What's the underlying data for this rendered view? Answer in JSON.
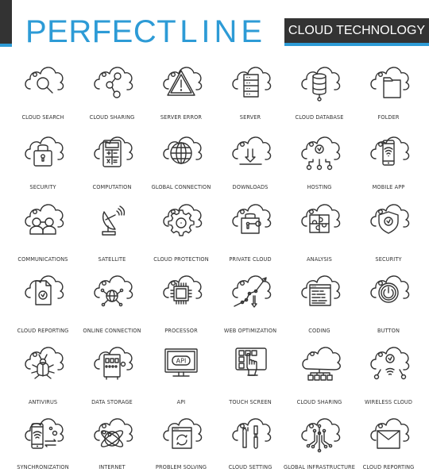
{
  "header": {
    "brand_bold": "PERFECT",
    "brand_thin": "LINE",
    "tag": "CLOUD TECHNOLOGY",
    "colors": {
      "accent": "#2d9bd6",
      "dark": "#333333",
      "stroke": "#333333"
    }
  },
  "icons": [
    [
      {
        "label": "CLOUD SEARCH",
        "icon": "cloud-search-icon"
      },
      {
        "label": "CLOUD SHARING",
        "icon": "cloud-sharing-icon"
      },
      {
        "label": "SERVER ERROR",
        "icon": "server-error-icon"
      },
      {
        "label": "SERVER",
        "icon": "server-icon"
      },
      {
        "label": "CLOUD DATABASE",
        "icon": "cloud-database-icon"
      },
      {
        "label": "FOLDER",
        "icon": "folder-icon"
      }
    ],
    [
      {
        "label": "SECURITY",
        "icon": "lock-icon"
      },
      {
        "label": "COMPUTATION",
        "icon": "calculator-icon"
      },
      {
        "label": "GLOBAL CONNECTION",
        "icon": "globe-icon"
      },
      {
        "label": "DOWNLOADS",
        "icon": "download-icon"
      },
      {
        "label": "HOSTING",
        "icon": "hosting-icon"
      },
      {
        "label": "MOBILE APP",
        "icon": "mobile-app-icon"
      }
    ],
    [
      {
        "label": "COMMUNICATIONS",
        "icon": "communications-icon"
      },
      {
        "label": "SATELLITE",
        "icon": "satellite-dish-icon"
      },
      {
        "label": "CLOUD PROTECTION",
        "icon": "gear-icon"
      },
      {
        "label": "PRIVATE CLOUD",
        "icon": "padlock-key-icon"
      },
      {
        "label": "ANALYSIS",
        "icon": "puzzle-icon"
      },
      {
        "label": "SECURITY",
        "icon": "shield-check-icon"
      }
    ],
    [
      {
        "label": "CLOUD REPORTING",
        "icon": "document-check-icon"
      },
      {
        "label": "ONLINE CONNECTION",
        "icon": "network-globe-icon"
      },
      {
        "label": "PROCESSOR",
        "icon": "chip-icon"
      },
      {
        "label": "WEB OPTIMIZATION",
        "icon": "growth-chart-icon"
      },
      {
        "label": "CODING",
        "icon": "code-window-icon"
      },
      {
        "label": "BUTTON",
        "icon": "power-button-icon"
      }
    ],
    [
      {
        "label": "ANTIVIRUS",
        "icon": "bug-icon"
      },
      {
        "label": "DATA STORAGE",
        "icon": "storage-unit-icon"
      },
      {
        "label": "API",
        "icon": "api-monitor-icon"
      },
      {
        "label": "TOUCH SCREEN",
        "icon": "touch-tablet-icon"
      },
      {
        "label": "CLOUD SHARING",
        "icon": "cloud-tree-icon"
      },
      {
        "label": "WIRELESS CLOUD",
        "icon": "wireless-cloud-icon"
      }
    ],
    [
      {
        "label": "SYNCHRONIZATION",
        "icon": "phone-sync-icon"
      },
      {
        "label": "INTERNET",
        "icon": "atom-globe-icon"
      },
      {
        "label": "PROBLEM SOLVING",
        "icon": "refresh-window-icon"
      },
      {
        "label": "CLOUD SETTING",
        "icon": "tools-icon"
      },
      {
        "label": "GLOBAL INFRASTRUCTURE",
        "icon": "circuit-icon"
      },
      {
        "label": "CLOUD REPORTING",
        "icon": "envelope-icon"
      }
    ]
  ]
}
